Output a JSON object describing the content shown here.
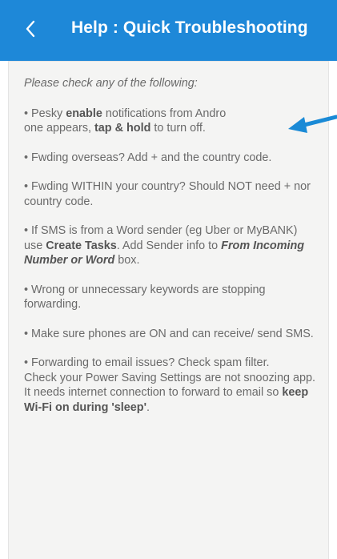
{
  "header": {
    "back_icon": "chevron-left-icon",
    "title": "Help : Quick Troubleshooting",
    "color": "#1e88d8"
  },
  "content": {
    "intro": "Please check any of the following:",
    "items": [
      {
        "bullet": "• ",
        "t1": "Pesky ",
        "b1": "enable",
        "t2": " notifications from Andro",
        "t3": "one appears, ",
        "b2": "tap & hold",
        "t4": " to turn off."
      },
      {
        "text": "• Fwding overseas? Add + and the country code."
      },
      {
        "text": "• Fwding WITHIN your country? Should NOT need + nor country code."
      },
      {
        "t1": "• If SMS is from a Word sender (eg Uber or MyBANK) use ",
        "b1": "Create Tasks",
        "t2": ". Add Sender info to ",
        "b2": "From Incoming Number or Word",
        "t3": " box."
      },
      {
        "text": "• Wrong or unnecessary keywords are stopping forwarding."
      },
      {
        "text": "• Make sure phones are ON and can receive/ send SMS."
      },
      {
        "l1": "• Forwarding to email issues? Check spam filter.",
        "l2a": "Check your Power Saving Settings are not snoozing app. It needs internet connection to forward to email so ",
        "l2b": "keep Wi-Fi on during 'sleep'",
        "l2c": "."
      }
    ]
  },
  "annotation": {
    "arrow_icon": "arrow-left-icon",
    "color": "#1a8ad6"
  }
}
